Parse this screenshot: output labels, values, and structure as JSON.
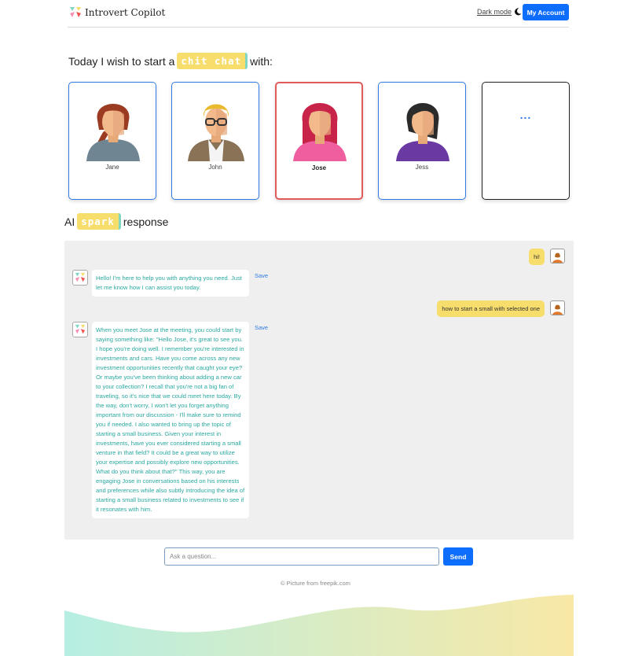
{
  "app": {
    "title": "Introvert Copilot",
    "dark_mode_label": "Dark mode",
    "account_button": "My Account"
  },
  "headline": {
    "prefix": "Today I wish to start a",
    "highlight": "chit chat",
    "suffix": "with:"
  },
  "people": [
    {
      "name": "Jane",
      "selected": false
    },
    {
      "name": "John",
      "selected": false
    },
    {
      "name": "Jose",
      "selected": true
    },
    {
      "name": "Jess",
      "selected": false
    }
  ],
  "more_label": "...",
  "spark": {
    "prefix": "AI",
    "highlight": "spark",
    "suffix": "response"
  },
  "chat": {
    "messages": [
      {
        "role": "user",
        "text": "hi!"
      },
      {
        "role": "bot",
        "text": "Hello! I'm here to help you with anything you need. Just let me know how I can assist you today.",
        "save_label": "Save"
      },
      {
        "role": "user",
        "text": "how to start a small with selected one"
      },
      {
        "role": "bot",
        "text": "When you meet Jose at the meeting, you could start by saying something like: \"Hello Jose, it's great to see you. I hope you're doing well. I remember you're interested in investments and cars. Have you come across any new investment opportunities recently that caught your eye? Or maybe you've been thinking about adding a new car to your collection? I recall that you're not a big fan of traveling, so it's nice that we could meet here today. By the way, don't worry, I won't let you forget anything important from our discussion - I'll make sure to remind you if needed. I also wanted to bring up the topic of starting a small business. Given your interest in investments, have you ever considered starting a small venture in that field? It could be a great way to utilize your expertise and possibly explore new opportunities. What do you think about that?\" This way, you are engaging Jose in conversations based on his interests and preferences while also subtly introducing the idea of starting a small business related to investments to see if it resonates with him.",
        "save_label": "Save"
      }
    ]
  },
  "input": {
    "placeholder": "Ask a question...",
    "value": "",
    "send_label": "Send"
  },
  "footer": {
    "credit": "© Picture from freepik.com"
  },
  "colors": {
    "accent": "#0d6efd",
    "highlight": "#f7dd6c",
    "bot_text": "#2aa8a0",
    "selected_border": "#e05a5a"
  }
}
